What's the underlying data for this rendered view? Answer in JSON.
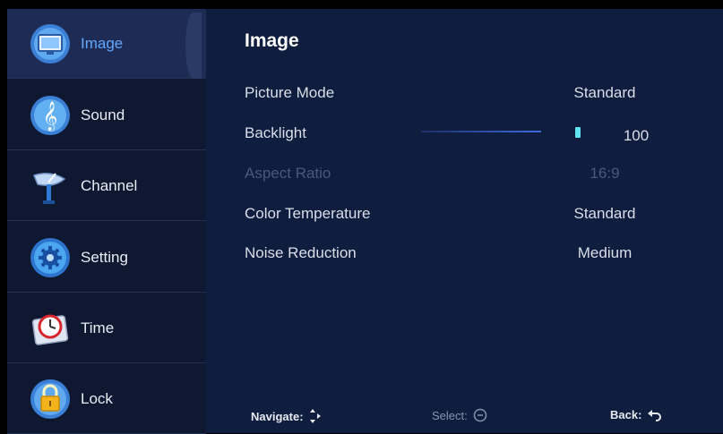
{
  "sidebar": {
    "items": [
      {
        "label": "Image",
        "icon": "image-icon",
        "selected": true
      },
      {
        "label": "Sound",
        "icon": "music-note-icon",
        "selected": false
      },
      {
        "label": "Channel",
        "icon": "satellite-dish-icon",
        "selected": false
      },
      {
        "label": "Setting",
        "icon": "gear-icon",
        "selected": false
      },
      {
        "label": "Time",
        "icon": "clock-icon",
        "selected": false
      },
      {
        "label": "Lock",
        "icon": "padlock-icon",
        "selected": false
      }
    ]
  },
  "panel": {
    "title": "Image",
    "rows": [
      {
        "name": "Picture Mode",
        "value": "Standard"
      },
      {
        "name": "Backlight",
        "value": "100"
      },
      {
        "name": "Aspect Ratio",
        "value": "16:9",
        "disabled": true
      },
      {
        "name": "Color Temperature",
        "value": "Standard"
      },
      {
        "name": "Noise Reduction",
        "value": "Medium"
      }
    ],
    "backlight_level_percent": 100
  },
  "hints": {
    "navigate": "Navigate:",
    "select": "Select:",
    "back": "Back:"
  },
  "colors": {
    "sidebar_bg": "#0e1830",
    "selected_bg": "#1e2c55",
    "main_bg": "#0f1d3e",
    "accent": "#63a8ff",
    "slider_thumb": "#5fe3f0"
  }
}
